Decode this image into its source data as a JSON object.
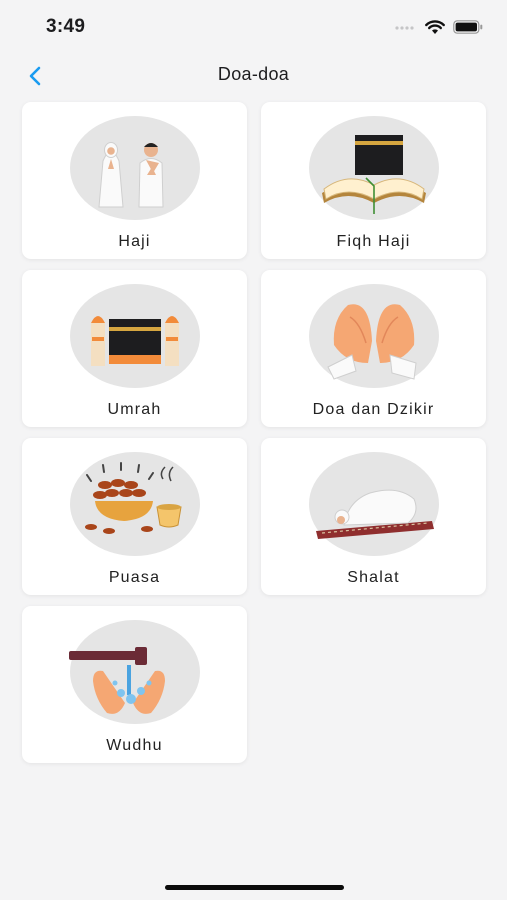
{
  "status_bar": {
    "time": "3:49"
  },
  "nav": {
    "title": "Doa-doa",
    "accent_color": "#1a9bf0"
  },
  "menu": [
    {
      "label": "Haji",
      "icon": "pilgrims-icon"
    },
    {
      "label": "Fiqh Haji",
      "icon": "kaaba-book-icon"
    },
    {
      "label": "Umrah",
      "icon": "kaaba-minarets-icon"
    },
    {
      "label": "Doa dan Dzikir",
      "icon": "praying-hands-icon"
    },
    {
      "label": "Puasa",
      "icon": "dates-tea-icon"
    },
    {
      "label": "Shalat",
      "icon": "prostration-icon"
    },
    {
      "label": "Wudhu",
      "icon": "ablution-hands-icon"
    }
  ]
}
